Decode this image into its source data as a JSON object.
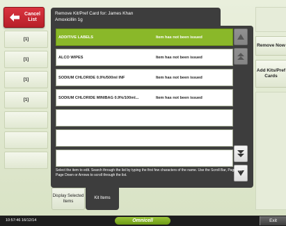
{
  "cancel_button": {
    "label": "Cancel List"
  },
  "quantities": [
    "[1]",
    "[1]",
    "[1]",
    "[1]",
    "",
    "",
    ""
  ],
  "header": {
    "title": "Remove Kit/Pref Card for: James Khan",
    "subtitle": "Amoxicillin 1g"
  },
  "items": [
    {
      "name": "ADDITIVE LABELS",
      "status": "Item has not been issued",
      "selected": true
    },
    {
      "name": "ALCO WIPES",
      "status": "Item has not been issued",
      "selected": false
    },
    {
      "name": "SODIUM CHLORIDE 0.9%/500ml INF",
      "status": "Item has not been issued",
      "selected": false
    },
    {
      "name": "SODIUM CHLORIDE MINIBAG 0.9%/100ml...",
      "status": "Item has not been issued",
      "selected": false
    },
    {
      "name": "",
      "status": "",
      "selected": false
    },
    {
      "name": "",
      "status": "",
      "selected": false
    },
    {
      "name": "",
      "status": "",
      "selected": false
    }
  ],
  "help_text": "Select the item to edit. Search through the list by typing the first few characters of the name.  Use the Scroll Bar, Page Up, Page Down or Arrows to scroll through the list.",
  "tabs": {
    "display_selected": "Display Selected Items",
    "kit_items": "Kit Items"
  },
  "right_buttons": {
    "remove_now": "Remove Now",
    "add_kits": "Add Kits/Pref Cards"
  },
  "footer": {
    "clock": "10:57:46  16/12/14",
    "brand": "Omnicell",
    "exit": "Exit"
  },
  "colors": {
    "selected_row": "#8ab829",
    "cancel_red": "#c82832",
    "panel_dark": "#3d3d3d"
  }
}
